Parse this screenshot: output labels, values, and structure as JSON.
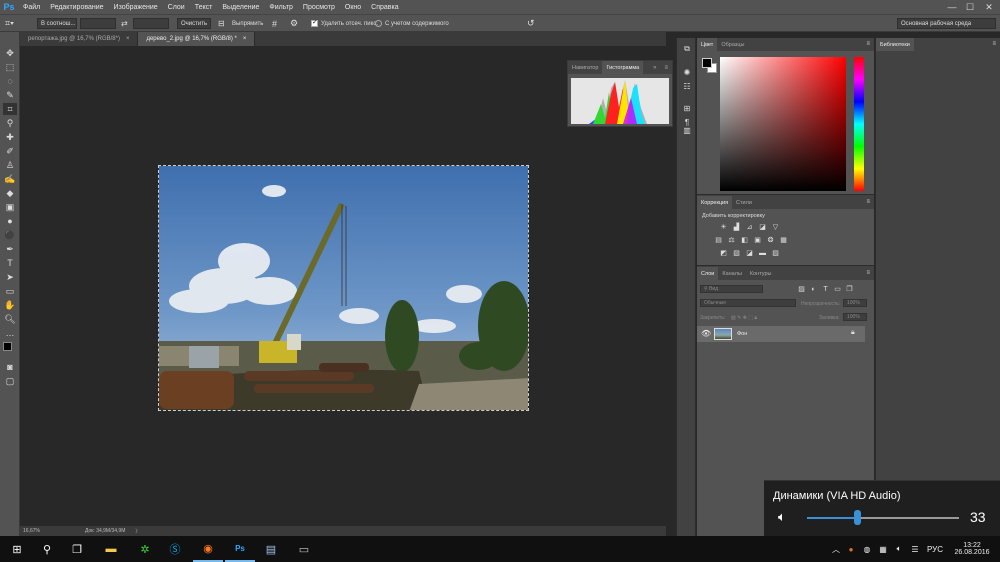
{
  "app": {
    "logo": "Ps"
  },
  "menu": [
    "Файл",
    "Редактирование",
    "Изображение",
    "Слои",
    "Текст",
    "Выделение",
    "Фильтр",
    "Просмотр",
    "Окно",
    "Справка"
  ],
  "window_controls": {
    "minimize": "—",
    "maximize": "☐",
    "close": "✕"
  },
  "options_bar": {
    "ratio_select": "В соотнош...",
    "clear_button": "Очистить",
    "straighten_button": "Выпрямить",
    "delete_cropped_label": "Удалить отсеч. пикс.",
    "content_aware_label": "С учетом содержимого",
    "workspace_select": "Основная рабочая среда"
  },
  "doc_tabs": [
    {
      "label": "репортажа.jpg @ 16,7% (RGB/8*)",
      "close": "×"
    },
    {
      "label": "дерево_2.jpg @ 16,7% (RGB/8) *",
      "close": "×"
    }
  ],
  "status": {
    "zoom": "16,67%",
    "doc": "Док: 34,9M/34,9M",
    "arrow": "〉"
  },
  "histogram_panel": {
    "tabs": [
      "Навигатор",
      "Гистограмма"
    ]
  },
  "color_panel": {
    "tabs": [
      "Цвет",
      "Образцы"
    ]
  },
  "adjustments_panel": {
    "tabs": [
      "Коррекция",
      "Стили"
    ],
    "title": "Добавить корректировку"
  },
  "layers_panel": {
    "tabs": [
      "Слои",
      "Каналы",
      "Контуры"
    ],
    "filter_placeholder": "Вид",
    "blend_mode": "Обычные",
    "opacity_label": "Непрозрачность:",
    "opacity_value": "100%",
    "lock_label": "Закрепить:",
    "fill_label": "Заливка:",
    "fill_value": "100%",
    "layer_name": "Фон"
  },
  "libraries_panel": {
    "title": "Библиотеки"
  },
  "volume": {
    "device": "Динамики (VIA HD Audio)",
    "level": 33,
    "level_fraction": 0.33
  },
  "taskbar": {
    "lang": "РУС",
    "time": "13:22",
    "date": "26.08.2016"
  },
  "colors": {
    "accent": "#31a8ff",
    "volume_accent": "#3a8fd6",
    "foreground": "#000000",
    "background": "#ffffff"
  }
}
